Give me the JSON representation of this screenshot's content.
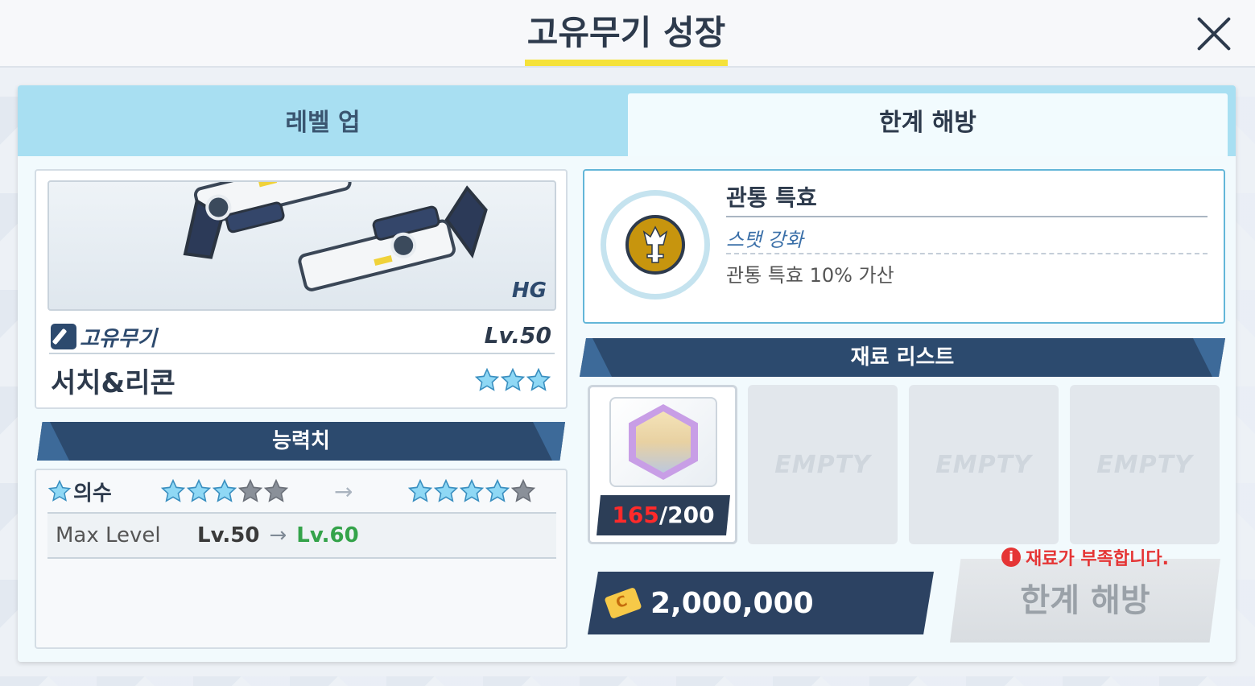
{
  "header": {
    "title": "고유무기 성장"
  },
  "tabs": [
    {
      "label": "레벨 업",
      "active": false
    },
    {
      "label": "한계 해방",
      "active": true
    }
  ],
  "weapon": {
    "class": "HG",
    "type_label": "고유무기",
    "level": "Lv.50",
    "name": "서치&리콘",
    "stars": 3
  },
  "stats": {
    "header": "능력치",
    "grade_label": "의수",
    "grade_from_stars": 3,
    "grade_from_max": 5,
    "grade_to_stars": 4,
    "grade_to_max": 5,
    "max_level_label": "Max Level",
    "max_level_from": "Lv.50",
    "max_level_to": "Lv.60"
  },
  "effect": {
    "title": "관통 특효",
    "subtitle": "스탯 강화",
    "description": "관통 특효 10% 가산",
    "icon": "sword-icon"
  },
  "materials": {
    "header": "재료 리스트",
    "items": [
      {
        "type": "character-token",
        "have": "165",
        "need": "/200"
      }
    ],
    "empty_label": "EMPTY",
    "empty_slots": 3
  },
  "cost": {
    "value": "2,000,000",
    "icon": "credit-card-icon"
  },
  "warning": {
    "text": "재료가 부족합니다."
  },
  "action_button": {
    "label": "한계 해방",
    "enabled": false
  },
  "colors": {
    "accent_yellow": "#f5e23a",
    "navy": "#2c4a6e",
    "tab_blue": "#a8dff2",
    "star_blue": "#8fd8f5",
    "star_gray": "#8a9099",
    "warning_red": "#e53535",
    "success_green": "#34a34a"
  }
}
